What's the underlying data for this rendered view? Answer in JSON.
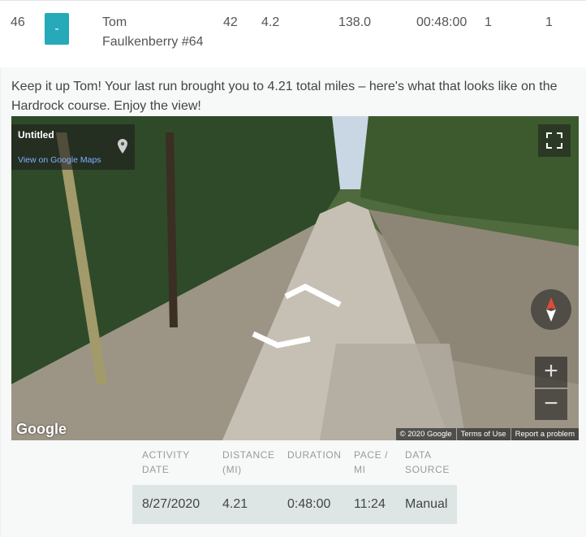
{
  "row": {
    "rank": "46",
    "button_label": "-",
    "name_line1": "Tom",
    "name_line2": "Faulkenberry #64",
    "col_age": "42",
    "col_miles": "4.2",
    "col_percent": "138.0",
    "col_time": "00:48:00",
    "col_a": "1",
    "col_b": "1"
  },
  "message": "Keep it up Tom! Your last run brought you to 4.21 total miles – here's what that looks like on the Hardrock course. Enjoy the view!",
  "map": {
    "title": "Untitled",
    "link": "View on Google Maps",
    "zoom_in": "+",
    "zoom_out": "−",
    "logo": "Google",
    "attribution": [
      "© 2020 Google",
      "Terms of Use",
      "Report a problem"
    ],
    "icons": [
      "pin-icon",
      "fullscreen-icon",
      "compass-icon"
    ]
  },
  "stats": {
    "headers": [
      [
        "ACTIVITY",
        "DATE"
      ],
      [
        "DISTANCE",
        "(MI)"
      ],
      [
        "DURATION",
        ""
      ],
      [
        "PACE /",
        "MI"
      ],
      [
        "DATA",
        "SOURCE"
      ]
    ],
    "values": [
      "8/27/2020",
      "4.21",
      "0:48:00",
      "11:24",
      "Manual"
    ]
  },
  "colors": {
    "accent_button": "#26a9b8",
    "stats_row_bg": "#dde6e4"
  }
}
